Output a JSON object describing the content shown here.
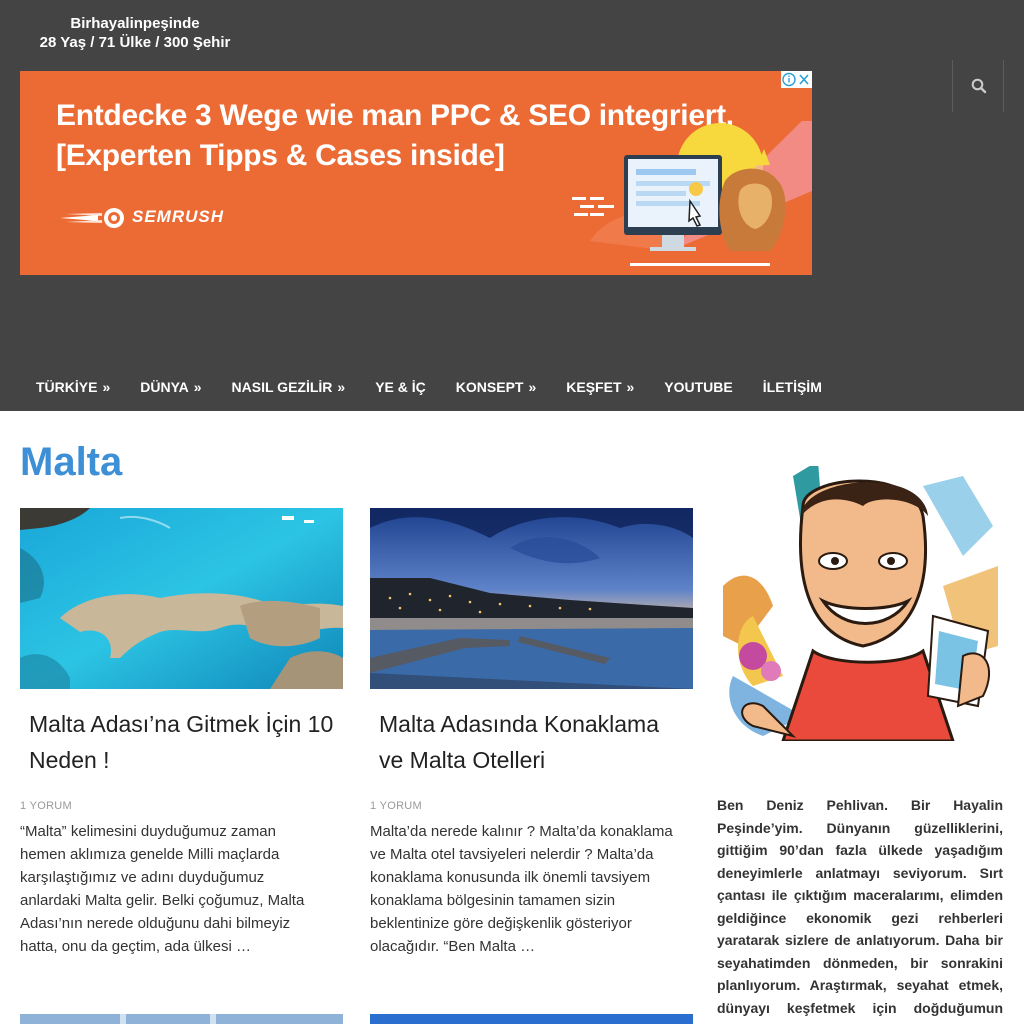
{
  "site": {
    "title": "Birhayalinpeşinde",
    "tagline": "28 Yaş / 71 Ülke / 300 Şehir"
  },
  "ad": {
    "line1": "Entdecke 3 Wege wie man PPC & SEO integriert.",
    "line2": "[Experten Tipps & Cases inside]",
    "brand": "SEMRUSH",
    "background": "#ec6b35"
  },
  "nav": {
    "items": [
      {
        "label": "TÜRKİYE",
        "has_submenu": true
      },
      {
        "label": "DÜNYA",
        "has_submenu": true
      },
      {
        "label": "NASIL GEZİLİR",
        "has_submenu": true
      },
      {
        "label": "YE & İÇ",
        "has_submenu": false
      },
      {
        "label": "KONSEPT",
        "has_submenu": true
      },
      {
        "label": "KEŞFET",
        "has_submenu": true
      },
      {
        "label": "YOUTUBE",
        "has_submenu": false
      },
      {
        "label": "İLETİŞİM",
        "has_submenu": false
      }
    ]
  },
  "page": {
    "title": "Malta",
    "accent": "#3d8fd6",
    "header_bg": "#444444"
  },
  "posts": [
    {
      "title": "Malta Adası’na Gitmek İçin 10 Neden !",
      "comments": "1 YORUM",
      "excerpt": "“Malta” kelimesini duyduğumuz zaman hemen aklımıza genelde Milli maçlarda karşılaştığımız ve adını duyduğumuz anlardaki Malta gelir. Belki çoğumuz, Malta Adası’nın nerede olduğunu dahi bilmeyiz hatta, onu da geçtim, ada ülkesi …"
    },
    {
      "title": "Malta Adasında Konaklama ve Malta Otelleri",
      "comments": "1 YORUM",
      "excerpt": "Malta’da nerede kalınır ? Malta’da konaklama ve Malta otel tavsiyeleri nelerdir ? Malta’da konaklama konusunda ilk önemli tavsiyem konaklama bölgesinin tamamen sizin beklentinize göre değişkenlik gösteriyor olacağıdır. “Ben Malta …"
    }
  ],
  "sidebar": {
    "about": "Ben Deniz Pehlivan. Bir Hayalin Peşinde’yim. Dünyanın güzelliklerini, gittiğim 90’dan fazla ülkede yaşadığım deneyimlerle anlatmayı seviyorum. Sırt çantası ile çıktığım maceralarımı, elimden geldiğince ekonomik gezi rehberleri yaratarak sizlere de anlatıyorum. Daha bir seyahatimden dönmeden, bir sonrakini planlıyorum. Araştırmak, seyahat etmek, dünyayı keşfetmek için doğduğumun farkındayım ve bu"
  }
}
